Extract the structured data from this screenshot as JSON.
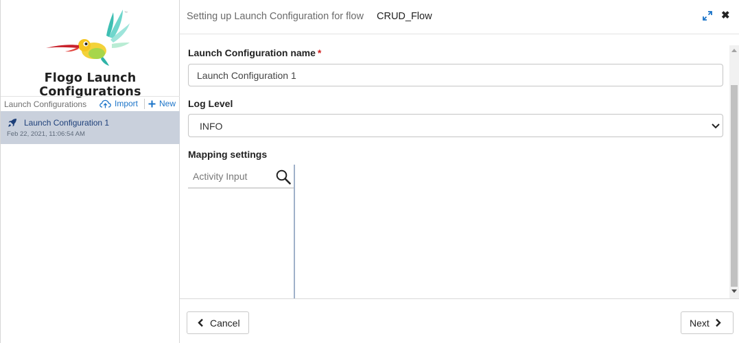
{
  "sidebar": {
    "app_title": "Flogo Launch Configurations",
    "list_header": {
      "label": "Launch Configurations",
      "import_label": "Import",
      "new_label": "New"
    },
    "items": [
      {
        "name": "Launch Configuration 1",
        "date": "Feb 22, 2021, 11:06:54 AM",
        "selected": true
      }
    ]
  },
  "header": {
    "title_prefix": "Setting up Launch Configuration for flow",
    "flow_name": "CRUD_Flow"
  },
  "form": {
    "name_label": "Launch Configuration name",
    "required_marker": "*",
    "name_value": "Launch Configuration 1",
    "log_level_label": "Log Level",
    "log_level_value": "INFO",
    "mapping_label": "Mapping settings",
    "activity_input_label": "Activity Input"
  },
  "footer": {
    "cancel_label": "Cancel",
    "next_label": "Next"
  },
  "colors": {
    "accent_blue": "#1a73c8",
    "selected_row": "#c9d0dc",
    "required_red": "#d01c1c"
  },
  "icons": {
    "logo": "hummingbird-logo",
    "import": "cloud-upload-icon",
    "new": "plus-icon",
    "item": "rocket-icon",
    "expand": "expand-icon",
    "close": "close-icon",
    "select": "chevron-down-icon",
    "search": "search-icon",
    "cancel": "chevron-left-icon",
    "next": "chevron-right-icon"
  }
}
